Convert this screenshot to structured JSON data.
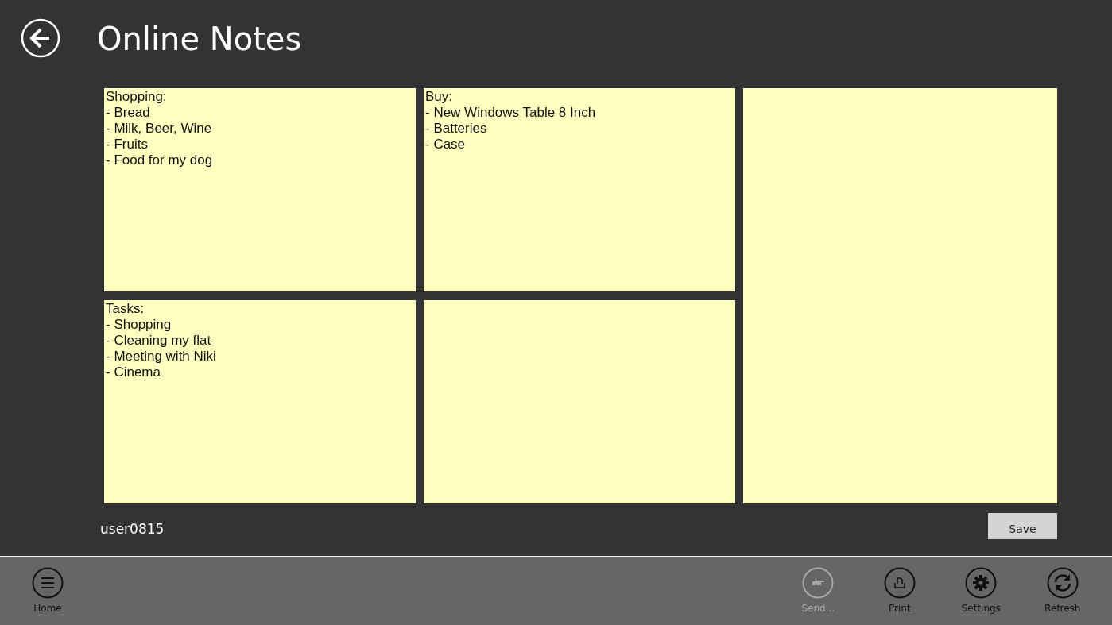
{
  "header": {
    "title": "Online Notes"
  },
  "notes": [
    {
      "kind": "normal",
      "text": "Shopping:\n- Bread\n- Milk, Beer, Wine\n- Fruits\n- Food for my dog"
    },
    {
      "kind": "normal",
      "text": "Buy:\n- New Windows Table 8 Inch\n- Batteries\n- Case"
    },
    {
      "kind": "tall"
    },
    {
      "kind": "normal",
      "text": "Tasks:\n- Shopping\n- Cleaning my flat\n- Meeting with Niki\n- Cinema"
    },
    {
      "kind": "normal"
    }
  ],
  "footer": {
    "user": "user0815",
    "save_button": "Save"
  },
  "app_bar": {
    "left": [
      {
        "kind": "menu",
        "label": "Home",
        "disabled": false
      }
    ],
    "right": [
      {
        "kind": "send",
        "label": "Send...",
        "disabled": true
      },
      {
        "kind": "print",
        "label": "Print",
        "disabled": false
      },
      {
        "kind": "settings",
        "label": "Settings",
        "disabled": false
      },
      {
        "kind": "refresh",
        "label": "Refresh",
        "disabled": false
      }
    ]
  }
}
